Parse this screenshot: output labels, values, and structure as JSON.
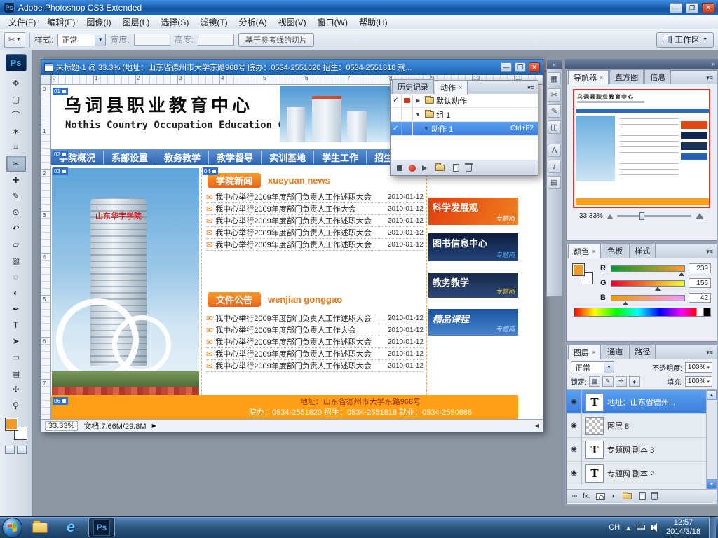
{
  "colors": {
    "accent_orange": "#EF9C2A",
    "nav_blue": "#2E6CB8",
    "footer_orange": "#FFA018",
    "selection_blue": "#3D7EDB"
  },
  "icons": {
    "envelope": "✉",
    "check": "✓",
    "expander_closed": "▶",
    "expander_open": "▼",
    "panel_menu": "▾≡",
    "collapse_left": "«",
    "collapse_right": "»",
    "tab_close": "×",
    "link": "∞",
    "fx": "fx.",
    "adjust": "◑",
    "dropdown_arrow": "▼"
  },
  "titlebar": {
    "app_icon": "Ps",
    "title": "Adobe Photoshop CS3 Extended",
    "minimize": "—",
    "maximize": "❐",
    "close": "✕"
  },
  "menubar": {
    "items": [
      "文件(F)",
      "编辑(E)",
      "图像(I)",
      "图层(L)",
      "选择(S)",
      "滤镜(T)",
      "分析(A)",
      "视图(V)",
      "窗口(W)",
      "帮助(H)"
    ]
  },
  "optionsbar": {
    "tool_icon": "✂",
    "style_label": "样式:",
    "style_value": "正常",
    "width_label": "宽度:",
    "height_label": "高度:",
    "slice_button": "基于参考线的切片",
    "workspace_label": "工作区"
  },
  "toolbox": {
    "logo": "Ps",
    "tools": [
      {
        "name": "move",
        "glyph": "✥"
      },
      {
        "name": "marquee",
        "glyph": "▢"
      },
      {
        "name": "lasso",
        "glyph": "⌒"
      },
      {
        "name": "magic-wand",
        "glyph": "✶"
      },
      {
        "name": "crop",
        "glyph": "⌗"
      },
      {
        "name": "slice",
        "glyph": "✂"
      },
      {
        "name": "healing-brush",
        "glyph": "✚"
      },
      {
        "name": "brush",
        "glyph": "✎"
      },
      {
        "name": "clone-stamp",
        "glyph": "⊙"
      },
      {
        "name": "history-brush",
        "glyph": "↶"
      },
      {
        "name": "eraser",
        "glyph": "▱"
      },
      {
        "name": "gradient",
        "glyph": "▨"
      },
      {
        "name": "blur",
        "glyph": "◌"
      },
      {
        "name": "dodge",
        "glyph": "◐"
      },
      {
        "name": "pen",
        "glyph": "✒"
      },
      {
        "name": "type",
        "glyph": "T"
      },
      {
        "name": "path-select",
        "glyph": "➤"
      },
      {
        "name": "shape",
        "glyph": "▭"
      },
      {
        "name": "notes",
        "glyph": "▤"
      },
      {
        "name": "hand",
        "glyph": "✣"
      },
      {
        "name": "zoom",
        "glyph": "⚲"
      }
    ]
  },
  "document": {
    "title": "未标题-1 @ 33.3% (地址：山东省德州市大学东路968号 院办：0534-2551620 招生：0534-2551818 就...",
    "zoom": "33.33%",
    "size_info": "文档:7.66M/29.8M",
    "ruler_h": [
      "0",
      "1",
      "2",
      "3",
      "4",
      "5",
      "6",
      "7",
      "8",
      "9",
      "10",
      "11"
    ],
    "ruler_v": [
      "0",
      "1",
      "2",
      "3",
      "4",
      "5",
      "6",
      "7"
    ]
  },
  "design": {
    "slices": [
      "01",
      "02",
      "03",
      "04",
      "06"
    ],
    "site_title": "乌词县职业教育中心",
    "site_subtitle": "Nothis Country Occupation Education Center",
    "tower_sign": "山东华宇学院",
    "nav_items": [
      "学院概况",
      "系部设置",
      "教务教学",
      "教学督导",
      "实训基地",
      "学生工作",
      "招生就业"
    ],
    "news": {
      "title": "学院新闻",
      "title_en": "xueyuan news",
      "items": [
        {
          "text": "我中心举行2009年度部门负责人工作述职大会",
          "date": "2010-01-12"
        },
        {
          "text": "我中心举行2009年度部门负责人工作大会",
          "date": "2010-01-12"
        },
        {
          "text": "我中心举行2009年度部门负责人工作述职大会",
          "date": "2010-01-12"
        },
        {
          "text": "我中心举行2009年度部门负责人工作述职大会",
          "date": "2010-01-12"
        },
        {
          "text": "我中心举行2009年度部门负责人工作述职大会",
          "date": "2010-01-12"
        }
      ]
    },
    "notices": {
      "title": "文件公告",
      "title_en": "wenjian gonggao",
      "items": [
        {
          "text": "我中心举行2009年度部门负责人工作述职大会",
          "date": "2010-01-12"
        },
        {
          "text": "我中心举行2009年度部门负责人工作大会",
          "date": "2010-01-12"
        },
        {
          "text": "我中心举行2009年度部门负责人工作述职大会",
          "date": "2010-01-12"
        },
        {
          "text": "我中心举行2009年度部门负责人工作述职大会",
          "date": "2010-01-12"
        },
        {
          "text": "我中心举行2009年度部门负责人工作述职大会",
          "date": "2010-01-12"
        }
      ]
    },
    "banners": [
      {
        "title": "科学发展观",
        "sub": "专题网"
      },
      {
        "title": "图书信息中心",
        "sub": "专题网"
      },
      {
        "title": "教务教学",
        "sub": "专题网"
      },
      {
        "title": "精品课程",
        "sub": "专题网"
      }
    ],
    "footer": {
      "line1": "地址：山东省德州市大学东路968号",
      "line2": "院办：0534-2551620  招生：0534-2551818  就业：0534-2550666"
    }
  },
  "actions_panel": {
    "tabs": [
      "历史记录",
      "动作"
    ],
    "rows": [
      {
        "label": "默认动作"
      },
      {
        "label": "组 1"
      },
      {
        "label": "动作 1",
        "shortcut": "Ctrl+F2"
      }
    ]
  },
  "navigator_panel": {
    "tabs": [
      "导航器",
      "直方图",
      "信息"
    ],
    "zoom": "33.33%"
  },
  "color_panel": {
    "tabs": [
      "颜色",
      "色板",
      "样式"
    ],
    "channels": [
      {
        "label": "R",
        "value": "239"
      },
      {
        "label": "G",
        "value": "156"
      },
      {
        "label": "B",
        "value": "42"
      }
    ]
  },
  "layers_panel": {
    "tabs": [
      "图层",
      "通道",
      "路径"
    ],
    "blend_mode": "正常",
    "opacity_label": "不透明度:",
    "opacity_value": "100%",
    "lock_label": "锁定:",
    "fill_label": "填充:",
    "fill_value": "100%",
    "lock_icons": [
      "▦",
      "✎",
      "✛",
      "♦"
    ],
    "layers": [
      {
        "thumb": "T",
        "name": "地址：山东省德州..."
      },
      {
        "thumb": "",
        "name": "图层 8"
      },
      {
        "thumb": "T",
        "name": "专题网 副本 3"
      },
      {
        "thumb": "T",
        "name": "专题网 副本 2"
      }
    ]
  },
  "taskbar": {
    "language": "CH",
    "time": "12:57",
    "date": "2014/3/18"
  }
}
